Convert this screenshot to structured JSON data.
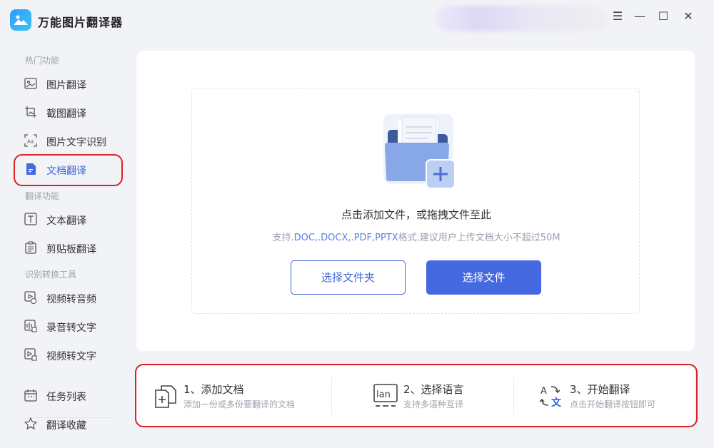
{
  "app": {
    "title": "万能图片翻译器"
  },
  "window": {
    "menu": "☰",
    "minimize": "—",
    "maximize": "☐",
    "close": "✕"
  },
  "sidebar": {
    "sections": [
      {
        "title": "热门功能",
        "items": [
          "图片翻译",
          "截图翻译",
          "图片文字识别",
          "文档翻译"
        ]
      },
      {
        "title": "翻译功能",
        "items": [
          "文本翻译",
          "剪贴板翻译"
        ]
      },
      {
        "title": "识别转换工具",
        "items": [
          "视频转音频",
          "录音转文字",
          "视频转文字"
        ]
      }
    ],
    "bottom_items": [
      "任务列表",
      "翻译收藏"
    ],
    "active_item": "文档翻译"
  },
  "upload": {
    "title": "点击添加文件，或拖拽文件至此",
    "hint_prefix": "支持",
    "hint_formats": ".DOC,.DOCX,.PDF,PPTX",
    "hint_suffix": "格式,建议用户上传文档大小不超过50M",
    "select_folder": "选择文件夹",
    "select_file": "选择文件"
  },
  "steps": [
    {
      "title": "1、添加文档",
      "desc": "添加一份或多份要翻译的文档",
      "icon": "add-document-icon"
    },
    {
      "title": "2、选择语言",
      "desc": "支持多语种互译",
      "icon": "language-icon"
    },
    {
      "title": "3、开始翻译",
      "desc": "点击开始翻译按钮即可",
      "icon": "translate-icon"
    }
  ],
  "colors": {
    "accent": "#4469e0",
    "highlight": "#dd2025"
  }
}
